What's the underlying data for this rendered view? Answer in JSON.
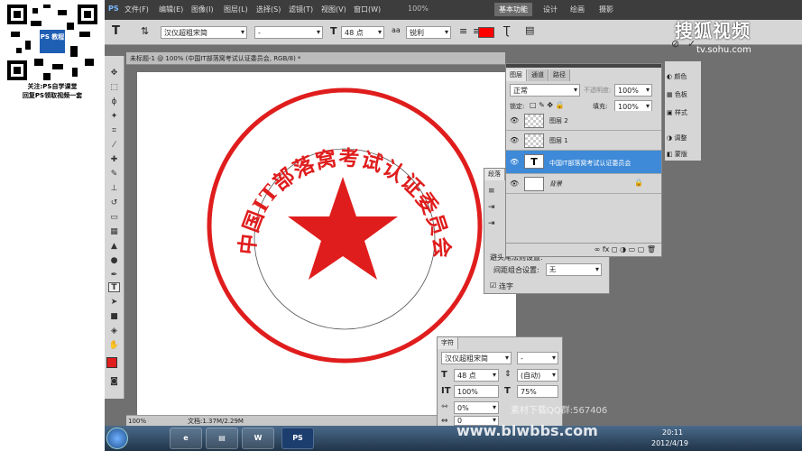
{
  "left_panel": {
    "line1": "关注:PS自学课堂",
    "line2": "回复PS领取视频一套",
    "qr_badge": "PS 教程"
  },
  "menubar": {
    "logo": "PS",
    "items": [
      "文件(F)",
      "编辑(E)",
      "图像(I)",
      "图层(L)",
      "选择(S)",
      "滤镜(T)",
      "视图(V)",
      "窗口(W)"
    ],
    "zoom": "100%",
    "workspaces": [
      "基本功能",
      "设计",
      "绘画",
      "摄影"
    ]
  },
  "options": {
    "font": "汉仪超粗宋简",
    "style": "-",
    "size": "48 点",
    "aa": "锐利",
    "color": "#ff0000"
  },
  "document": {
    "tab": "未标题-1 @ 100% (中国IT部落窝考试认证委员会, RGB/8) *",
    "zoom": "100%",
    "docsize": "文档:1.37M/2.29M"
  },
  "seal": {
    "text": "中国IT部落窝考试认证委员会",
    "color": "#e01d1d"
  },
  "layers_panel": {
    "tabs": [
      "图层",
      "通道",
      "路径"
    ],
    "blend": "正常",
    "opacity_label": "不透明度:",
    "opacity": "100%",
    "lock_label": "锁定:",
    "fill_label": "填充:",
    "fill": "100%",
    "layers": [
      {
        "name": "图层 2"
      },
      {
        "name": "图层 1"
      },
      {
        "name": "中国IT部落窝考试认证委员会",
        "type": "T"
      },
      {
        "name": "背景"
      }
    ]
  },
  "paragraph_panel": {
    "tab": "段落",
    "row1": "避头尾法则设置:",
    "row2": "间距组合设置:",
    "row2_val": "无",
    "row3": "连字"
  },
  "char_panel": {
    "tab": "字符",
    "font": "汉仪超粗宋简",
    "style": "-",
    "size": "48 点",
    "leading": "(自动)",
    "vscale": "100%",
    "hscale": "75%",
    "track": "0%",
    "kern": "0"
  },
  "right_strip": {
    "items": [
      "颜色",
      "色板",
      "样式",
      "调整",
      "蒙版"
    ]
  },
  "taskbar": {
    "time": "20:11",
    "date": "2012/4/19",
    "apps": [
      "W",
      "PS"
    ]
  },
  "watermarks": {
    "sohu": "搜狐视频",
    "sohu_url": "tv.sohu.com",
    "site": "www.blwbbs.com",
    "sub": "素材下载QQ群:567406"
  }
}
